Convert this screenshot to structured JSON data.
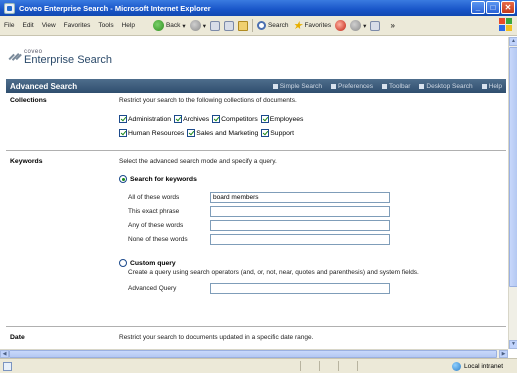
{
  "window": {
    "title": "Coveo Enterprise Search - Microsoft Internet Explorer",
    "controls": {
      "minimize": "_",
      "maximize": "□",
      "close": "✕"
    }
  },
  "menubar": {
    "items": [
      "File",
      "Edit",
      "View",
      "Favorites",
      "Tools",
      "Help"
    ],
    "back_label": "Back",
    "search_label": "Search",
    "favorites_label": "Favorites",
    "more_glyph": "»"
  },
  "logo": {
    "small": "coveo",
    "big": "Enterprise Search"
  },
  "navbar": {
    "title": "Advanced Search",
    "links": [
      "Simple Search",
      "Preferences",
      "Toolbar",
      "Desktop Search",
      "Help"
    ]
  },
  "collections": {
    "label": "Collections",
    "description": "Restrict your search to the following collections of documents.",
    "row1": [
      {
        "label": "Administration",
        "checked": true
      },
      {
        "label": "Archives",
        "checked": true
      },
      {
        "label": "Competitors",
        "checked": true
      },
      {
        "label": "Employees",
        "checked": true
      }
    ],
    "row2": [
      {
        "label": "Human Resources",
        "checked": true
      },
      {
        "label": "Sales and Marketing",
        "checked": true
      },
      {
        "label": "Support",
        "checked": true
      }
    ]
  },
  "keywords": {
    "label": "Keywords",
    "description": "Select the advanced search mode and specify a query.",
    "mode_keywords": "Search for keywords",
    "fields": [
      {
        "label": "All of these words",
        "value": "board members"
      },
      {
        "label": "This exact phrase",
        "value": ""
      },
      {
        "label": "Any of these words",
        "value": ""
      },
      {
        "label": "None of these words",
        "value": ""
      }
    ],
    "mode_custom": "Custom query",
    "custom_description": "Create a query using search operators (and, or, not, near, quotes and parenthesis) and system fields.",
    "advanced_query_label": "Advanced Query",
    "advanced_query_value": ""
  },
  "date": {
    "label": "Date",
    "description": "Restrict your search to documents updated in a specific date range."
  },
  "statusbar": {
    "zone": "Local intranet"
  },
  "colors": {
    "navbar": "#3d5c7c",
    "titlebar": "#1855c8",
    "check": "#1c8a1c"
  }
}
